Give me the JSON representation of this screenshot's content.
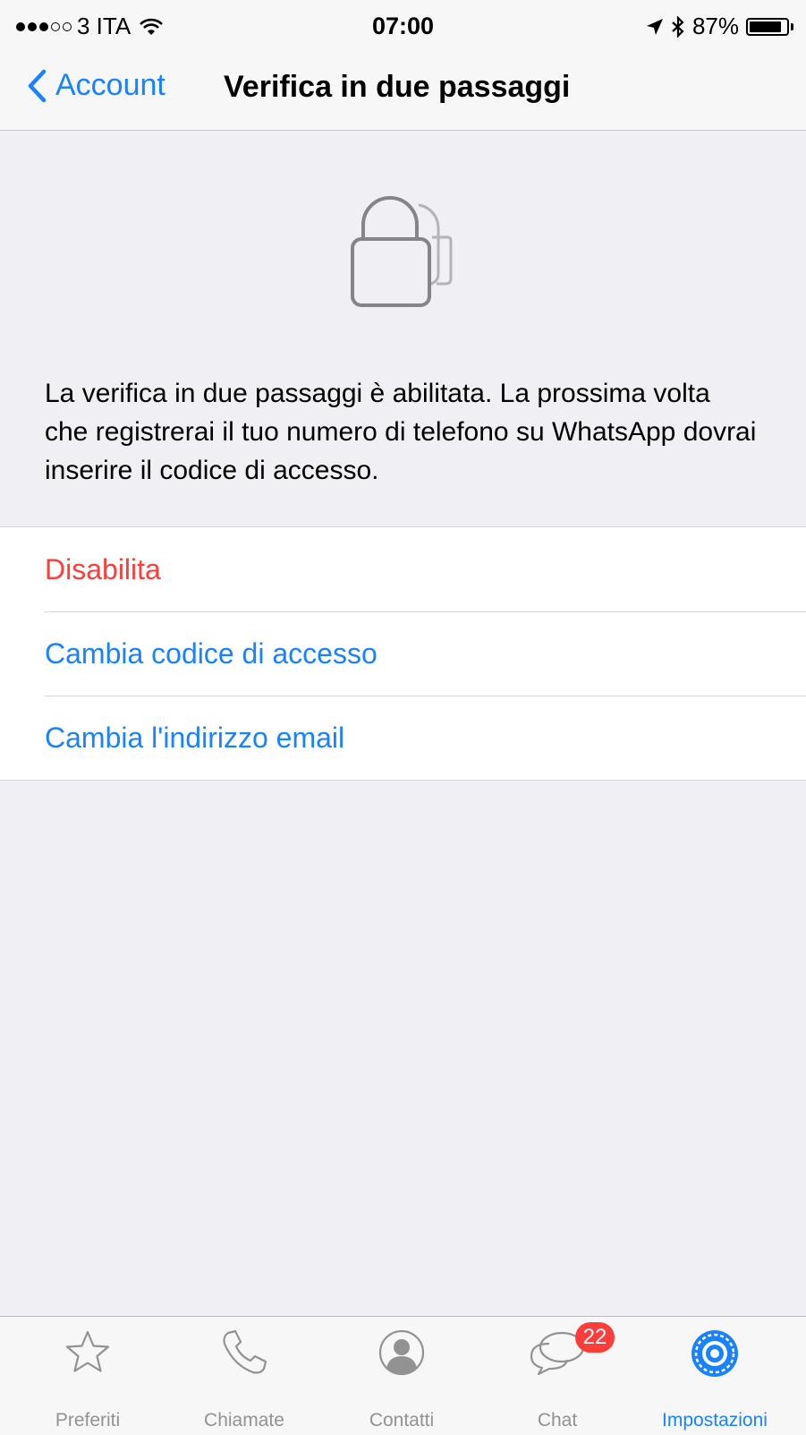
{
  "status_bar": {
    "carrier": "3 ITA",
    "time": "07:00",
    "battery_percent": "87%",
    "battery_level": 0.87,
    "icons": [
      "signal-dots",
      "wifi-icon",
      "location-arrow-icon",
      "bluetooth-icon",
      "battery-icon"
    ]
  },
  "nav": {
    "back_label": "Account",
    "title": "Verifica in due passaggi"
  },
  "hero": {
    "icon": "lock-icon",
    "text": "La verifica in due passaggi è abilitata. La prossima volta che registrerai il tuo numero di telefono su WhatsApp dovrai inserire il codice di accesso."
  },
  "options": [
    {
      "label": "Disabilita",
      "style": "destructive",
      "color": "#fc3d39"
    },
    {
      "label": "Cambia codice di accesso",
      "style": "link",
      "color": "#1a82fb"
    },
    {
      "label": "Cambia l'indirizzo email",
      "style": "link",
      "color": "#1a82fb"
    }
  ],
  "tab_bar": {
    "tabs": [
      {
        "label": "Preferiti",
        "icon": "star-icon",
        "active": false
      },
      {
        "label": "Chiamate",
        "icon": "phone-icon",
        "active": false
      },
      {
        "label": "Contatti",
        "icon": "contact-icon",
        "active": false
      },
      {
        "label": "Chat",
        "icon": "chat-bubbles-icon",
        "active": false,
        "badge": "22"
      },
      {
        "label": "Impostazioni",
        "icon": "settings-gear-icon",
        "active": true
      }
    ]
  },
  "colors": {
    "accent": "#1a82fb",
    "destructive": "#fc3d39",
    "background": "#efeff4",
    "inactive_tab": "#929292"
  }
}
